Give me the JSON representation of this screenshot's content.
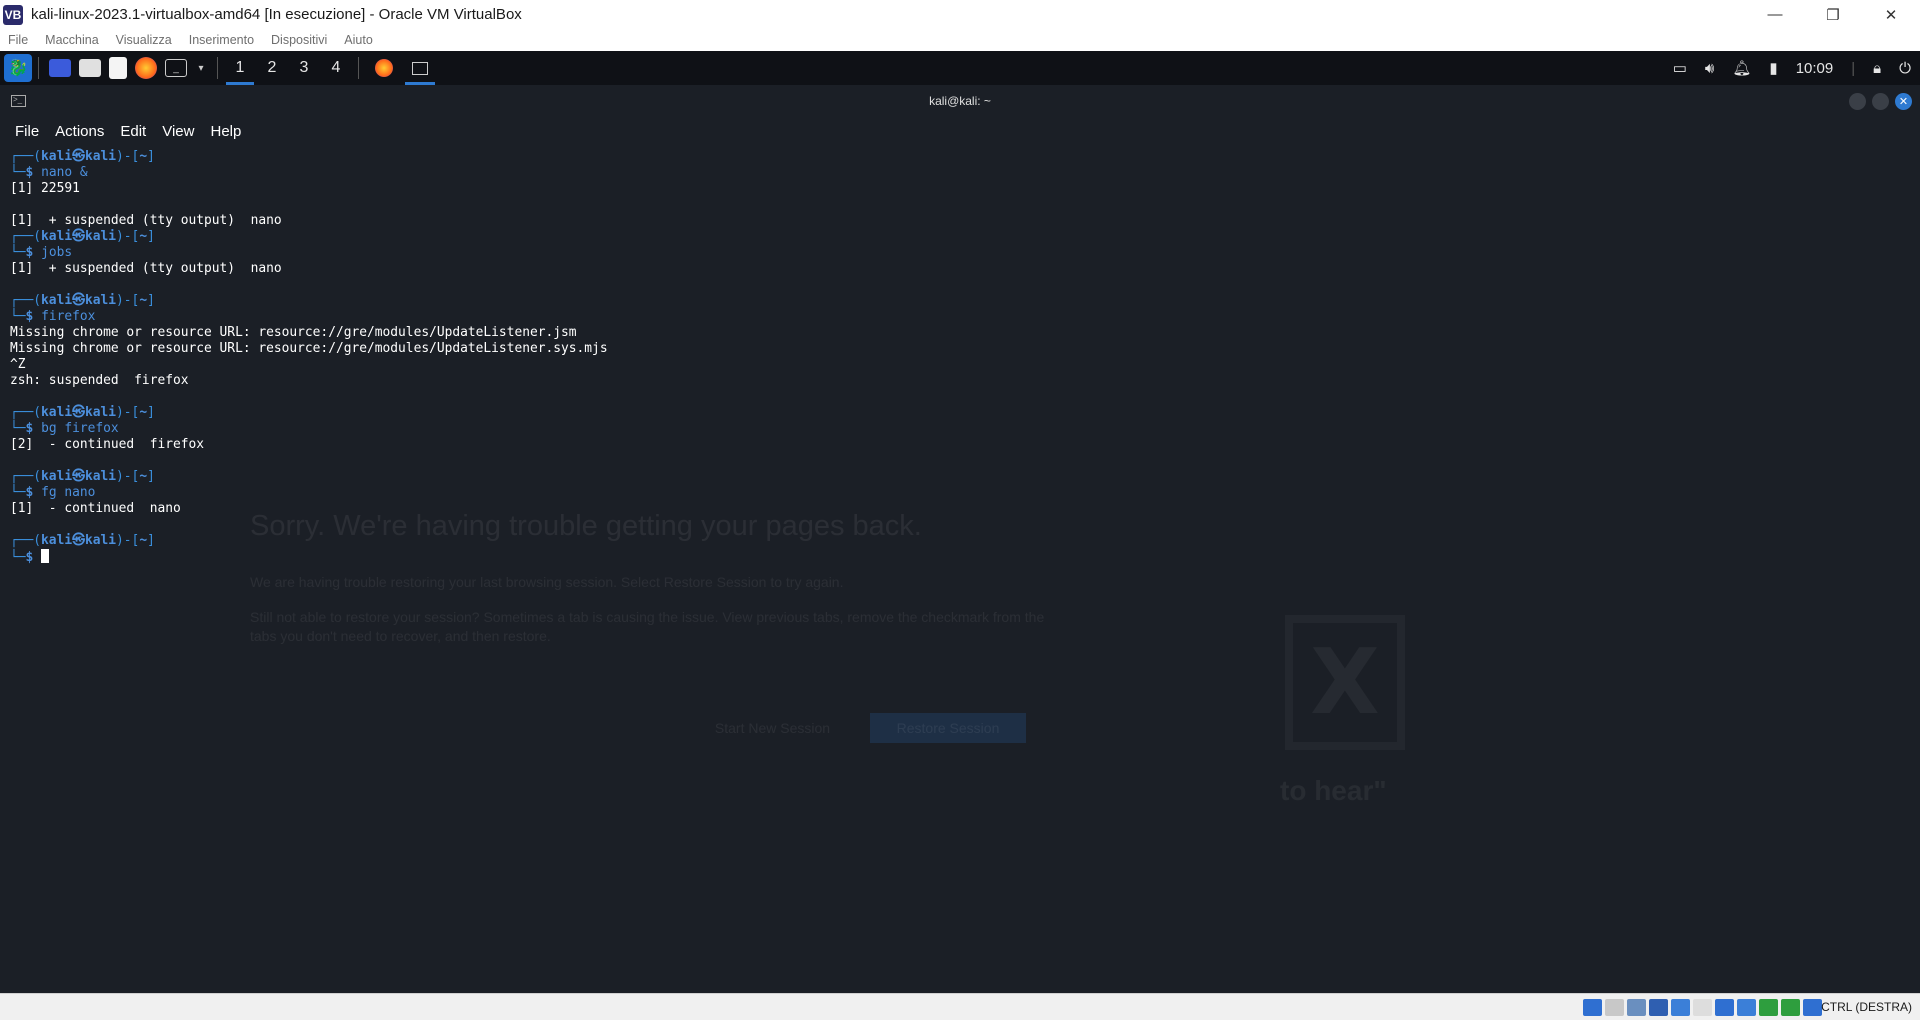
{
  "host": {
    "title": "kali-linux-2023.1-virtualbox-amd64 [In esecuzione] - Oracle VM VirtualBox",
    "logo_glyph": "VB",
    "menu": [
      "File",
      "Macchina",
      "Visualizza",
      "Inserimento",
      "Dispositivi",
      "Aiuto"
    ],
    "controls": {
      "minimize": "—",
      "restore": "❐",
      "close": "✕"
    },
    "host_key": "CTRL (DESTRA)",
    "status_icons": [
      "hdd-icon",
      "optical-icon",
      "audio-icon",
      "network-icon",
      "usb-icon",
      "shared-folder-icon",
      "display-icon",
      "recording-icon",
      "cpu-icon",
      "mouse-integration-icon",
      "keyboard-icon"
    ],
    "status_colors": [
      "#2f6fd1",
      "#c8c8c8",
      "#6a8fbf",
      "#2f5fb1",
      "#3b7fd8",
      "#dddddd",
      "#2f6fd1",
      "#3b7fd8",
      "#2e9e3e",
      "#2e9e3e",
      "#2f6fd1"
    ]
  },
  "panel": {
    "workspaces": [
      "1",
      "2",
      "3",
      "4"
    ],
    "active_workspace": 0,
    "clock": "10:09",
    "launchers": [
      "kali-menu-icon",
      "desktop-icon",
      "files-icon",
      "text-editor-icon",
      "firefox-icon",
      "terminal-icon"
    ],
    "tasks": [
      "firefox-task-icon",
      "terminal-task-icon"
    ]
  },
  "terminal": {
    "title": "kali@kali: ~",
    "menu": [
      "File",
      "Actions",
      "Edit",
      "View",
      "Help"
    ],
    "prompt": {
      "frame_top": "┌──(",
      "user": "kali㉿kali",
      "frame_mid": ")-[",
      "path": "~",
      "frame_end": "]",
      "frame_bottom": "└─",
      "sign": "$ "
    },
    "blocks": [
      {
        "cmd": "nano &",
        "output": [
          "[1] 22591",
          "",
          "[1]  + suspended (tty output)  nano"
        ]
      },
      {
        "cmd": "jobs",
        "output": [
          "[1]  + suspended (tty output)  nano",
          ""
        ]
      },
      {
        "cmd": "firefox",
        "output": [
          "Missing chrome or resource URL: resource://gre/modules/UpdateListener.jsm",
          "Missing chrome or resource URL: resource://gre/modules/UpdateListener.sys.mjs",
          "^Z",
          "zsh: suspended  firefox",
          ""
        ]
      },
      {
        "cmd": "bg firefox",
        "output": [
          "[2]  - continued  firefox",
          ""
        ]
      },
      {
        "cmd": "fg nano",
        "output": [
          "[1]  - continued  nano",
          ""
        ]
      },
      {
        "cmd": "",
        "output": []
      }
    ]
  },
  "background_firefox": {
    "heading": "Sorry. We're having trouble getting your pages back.",
    "p1": "We are having trouble restoring your last browsing session. Select Restore Session to try again.",
    "p2": "Still not able to restore your session? Sometimes a tab is causing the issue. View previous tabs, remove the checkmark from the tabs you don't need to recover, and then restore.",
    "btn_new": "Start New Session",
    "btn_restore": "Restore Session"
  },
  "wallpaper": {
    "mark": "X",
    "text": "to hear\""
  }
}
